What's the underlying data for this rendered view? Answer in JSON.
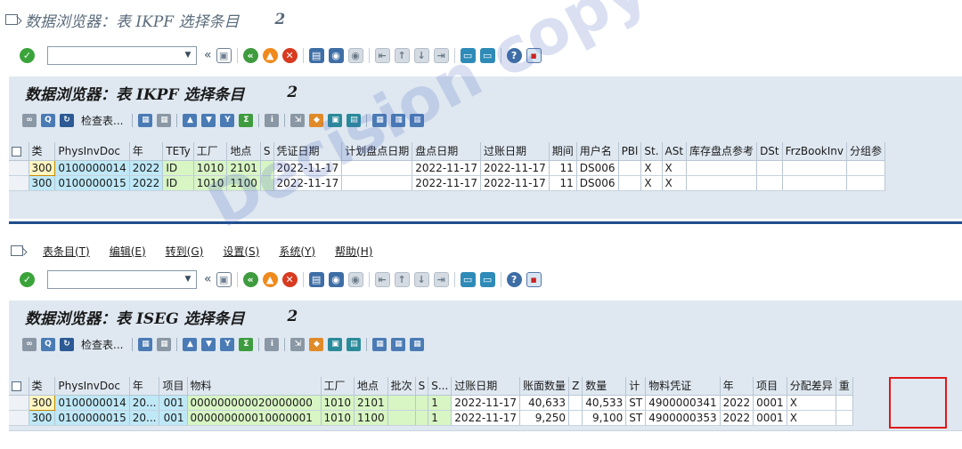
{
  "top_window": {
    "title": "数据浏览器：表 IKPF 选择条目",
    "title_count": "2"
  },
  "toolbar": {
    "command_placeholder": "",
    "icons": [
      "ok-icon",
      "back-double-arrow-icon",
      "save-icon",
      "back-icon",
      "exit-icon",
      "cancel-icon",
      "print-icon",
      "find-icon",
      "find-next-icon",
      "first-page-icon",
      "previous-page-icon",
      "next-page-icon",
      "last-page-icon",
      "new-session-icon",
      "shortcut-icon",
      "help-icon",
      "layout-icon"
    ]
  },
  "ikpf": {
    "title": "数据浏览器：表 IKPF 选择条目",
    "count": "2",
    "check_label": "检查表...",
    "columns": [
      "类",
      "PhysInvDoc",
      "年",
      "TETy",
      "工厂",
      "地点",
      "S",
      "凭证日期",
      "计划盘点日期",
      "盘点日期",
      "过账日期",
      "期间",
      "用户名",
      "PBl",
      "St.",
      "ASt",
      "库存盘点参考",
      "DSt",
      "FrzBookInv",
      "分组参"
    ],
    "rows": [
      [
        "300",
        "0100000014",
        "2022",
        "ID",
        "1010",
        "2101",
        "",
        "2022-11-17",
        "",
        "2022-11-17",
        "2022-11-17",
        "11",
        "DS006",
        "",
        "X",
        "X",
        "",
        "",
        "",
        ""
      ],
      [
        "300",
        "0100000015",
        "2022",
        "ID",
        "1010",
        "1100",
        "",
        "2022-11-17",
        "",
        "2022-11-17",
        "2022-11-17",
        "11",
        "DS006",
        "",
        "X",
        "X",
        "",
        "",
        "",
        ""
      ]
    ]
  },
  "menu": {
    "items": [
      "表条目(T)",
      "编辑(E)",
      "转到(G)",
      "设置(S)",
      "系统(Y)",
      "帮助(H)"
    ]
  },
  "iseg": {
    "title": "数据浏览器：表 ISEG 选择条目",
    "count": "2",
    "check_label": "检查表...",
    "columns": [
      "类",
      "PhysInvDoc",
      "年",
      "项目",
      "物料",
      "工厂",
      "地点",
      "批次",
      "S",
      "S...",
      "过账日期",
      "账面数量",
      "Z",
      "数量",
      "计",
      "物料凭证",
      "年",
      "项目",
      "分配差异",
      "重"
    ],
    "rows": [
      [
        "300",
        "0100000014",
        "20...",
        "001",
        "000000000020000000",
        "1010",
        "2101",
        "",
        "",
        "1",
        "2022-11-17",
        "40,633",
        "",
        "40,533",
        "ST",
        "4900000341",
        "2022",
        "0001",
        "X",
        ""
      ],
      [
        "300",
        "0100000015",
        "20...",
        "001",
        "000000000010000001",
        "1010",
        "1100",
        "",
        "",
        "1",
        "2022-11-17",
        "9,250",
        "",
        "9,100",
        "ST",
        "4900000353",
        "2022",
        "0001",
        "X",
        ""
      ]
    ]
  },
  "watermark": "Decision copyright",
  "colors": {
    "panel_bg": "#dfe8f1",
    "key_cell": "#bfe8f7",
    "data_cell": "#d8f5c4",
    "highlight_border": "#e01818"
  }
}
